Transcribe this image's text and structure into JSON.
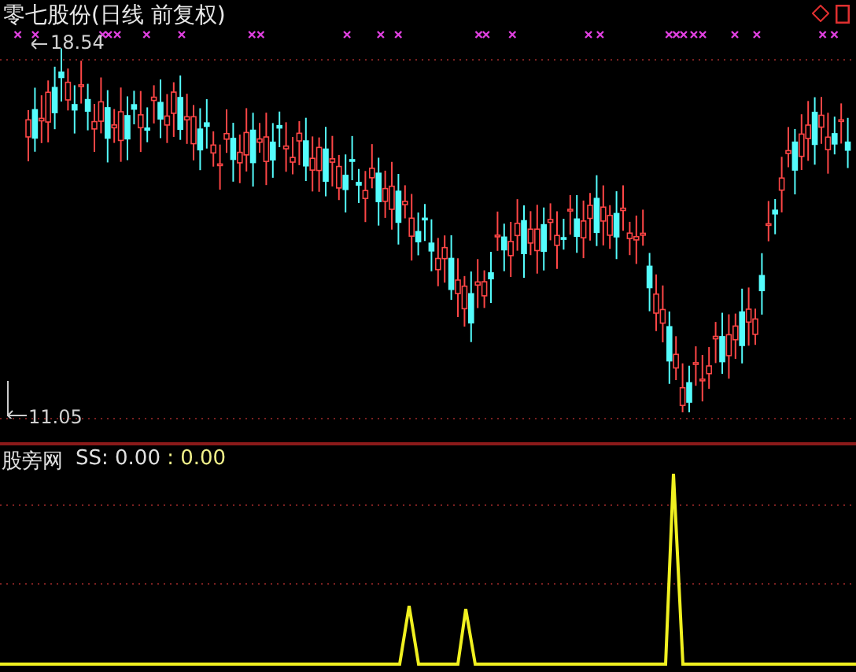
{
  "main_chart": {
    "title": "零七股份(日线 前复权)",
    "high_label": "18.54",
    "low_label": "11.05"
  },
  "indicator": {
    "name": "股旁网",
    "reading": "SS: 0.00",
    "value": ": 0.00"
  }
}
